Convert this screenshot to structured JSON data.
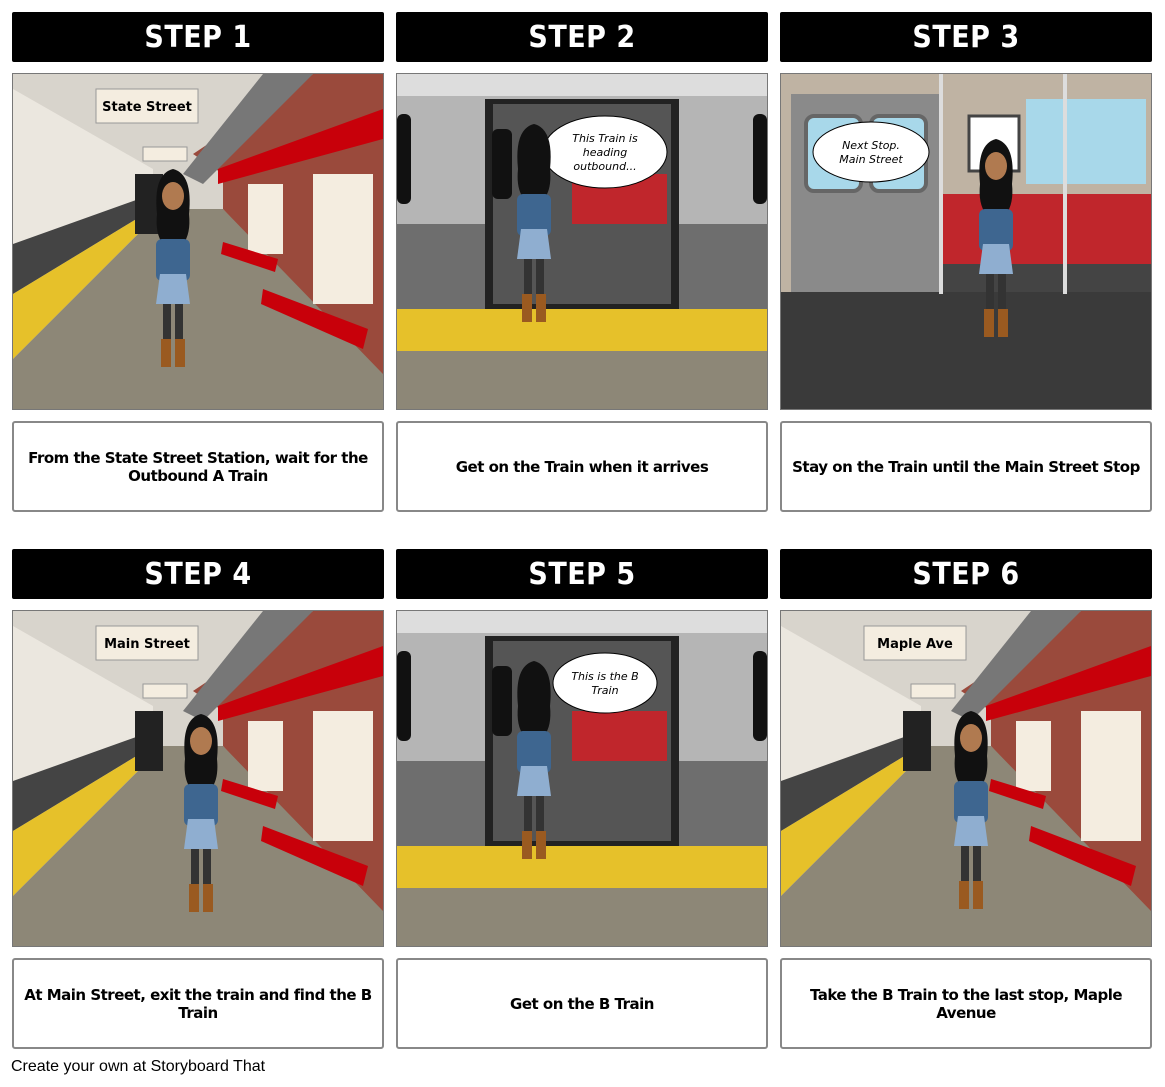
{
  "panels": [
    {
      "title": "STEP 1",
      "scene": "station",
      "sign": "State Street",
      "pose": "phone",
      "caption": "From the State Street Station, wait for the Outbound A Train"
    },
    {
      "title": "STEP 2",
      "scene": "train-door",
      "bubble": [
        "This Train is",
        "heading",
        "outbound..."
      ],
      "caption": "Get on the Train when it arrives"
    },
    {
      "title": "STEP 3",
      "scene": "train-interior",
      "bubble": [
        "Next Stop.",
        "Main Street"
      ],
      "caption": "Stay on the Train until the Main Street Stop"
    },
    {
      "title": "STEP 4",
      "scene": "station",
      "sign": "Main Street",
      "pose": "stand",
      "caption": "At Main Street, exit the train and find the B Train"
    },
    {
      "title": "STEP 5",
      "scene": "train-door",
      "bubble": [
        "This is the B",
        "Train"
      ],
      "caption": "Get on the B Train"
    },
    {
      "title": "STEP 6",
      "scene": "station",
      "sign": "Maple Ave",
      "pose": "shrug",
      "caption": "Take the B Train to the last stop, Maple Avenue"
    }
  ],
  "footer": "Create your own at Storyboard That",
  "colors": {
    "header": "#000000",
    "bench": "#c8000a",
    "platform_stripe": "#e6c12a",
    "brick": "#9a4a3c",
    "window": "#a8d8ea"
  }
}
